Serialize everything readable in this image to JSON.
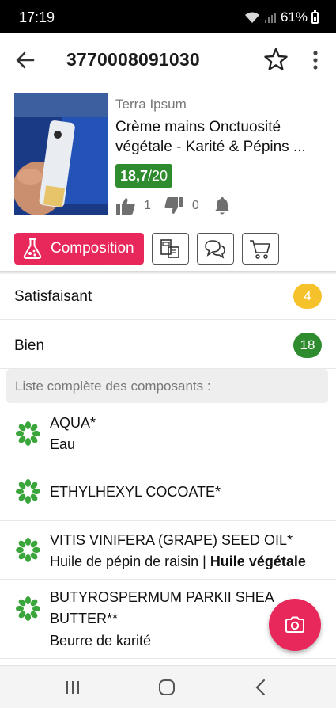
{
  "status_bar": {
    "time": "17:19",
    "battery": "61%"
  },
  "app_bar": {
    "title": "3770008091030",
    "back_icon": "arrow-left-icon",
    "favorite_icon": "star-outline-icon",
    "more_icon": "more-vert-icon"
  },
  "product": {
    "brand": "Terra Ipsum",
    "name": "Crème mains Onctuosité végétale - Karité & Pépins ...",
    "score": "18,7",
    "score_max": "/20",
    "likes": "1",
    "dislikes": "0"
  },
  "actions": {
    "composition_label": "Composition",
    "icons": [
      "product-compare-icon",
      "comments-icon",
      "cart-icon"
    ]
  },
  "ratings": [
    {
      "label": "Satisfaisant",
      "count": "4",
      "color": "#f6c22b"
    },
    {
      "label": "Bien",
      "count": "18",
      "color": "#2e8b2e"
    }
  ],
  "section_title": "Liste complète des composants :",
  "ingredients": [
    {
      "name": "AQUA*",
      "sub": "Eau",
      "sub_bold": ""
    },
    {
      "name": "ETHYLHEXYL COCOATE*",
      "sub": "",
      "sub_bold": ""
    },
    {
      "name": "VITIS VINIFERA (GRAPE) SEED OIL*",
      "sub": "Huile de pépin de raisin | ",
      "sub_bold": "Huile végétale"
    },
    {
      "name_line1": "BUTYROSPERMUM PARKII SHEA",
      "name_line2": "BUTTER**",
      "sub": "Beurre de karité",
      "sub_bold": ""
    }
  ],
  "colors": {
    "accent": "#e8285a",
    "good_green": "#2e8b2e",
    "flower_green": "#3aa53a"
  }
}
